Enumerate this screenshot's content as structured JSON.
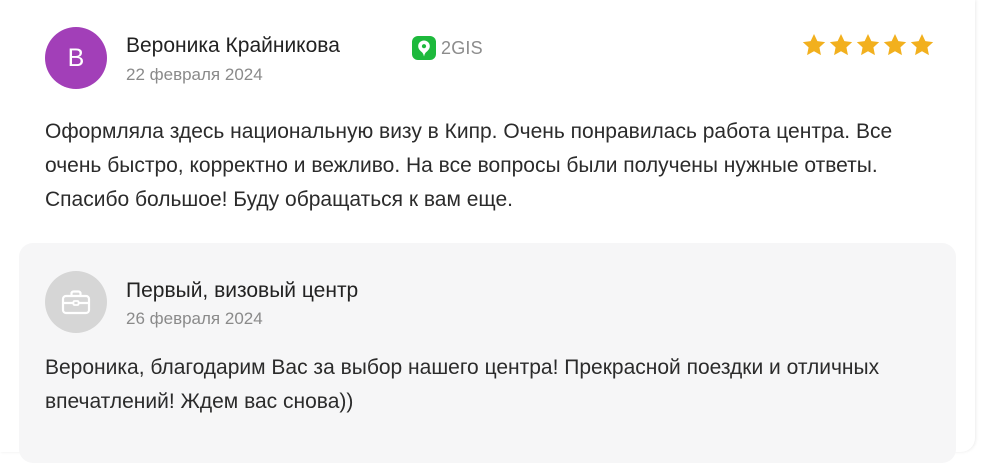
{
  "review": {
    "avatar_letter": "В",
    "avatar_color": "#a23fb8",
    "author": "Вероника Крайникова",
    "source_label": "2GIS",
    "source_icon": "2gis-icon",
    "source_color": "#1db93c",
    "date": "22 февраля 2024",
    "rating": 5,
    "rating_max": 5,
    "star_color": "#f2b01e",
    "text": "Оформляла здесь национальную визу в Кипр. Очень понравилась работа центра. Все очень быстро, корректно и вежливо. На все вопросы были получены нужные ответы. Спасибо большое! Буду обращаться к вам еще."
  },
  "reply": {
    "avatar_icon": "briefcase-icon",
    "author": "Первый, визовый центр",
    "date": "26 февраля 2024",
    "text": "Вероника, благодарим Вас за выбор нашего центра! Прекрасной поездки и отличных впечатлений! Ждем вас снова))"
  }
}
